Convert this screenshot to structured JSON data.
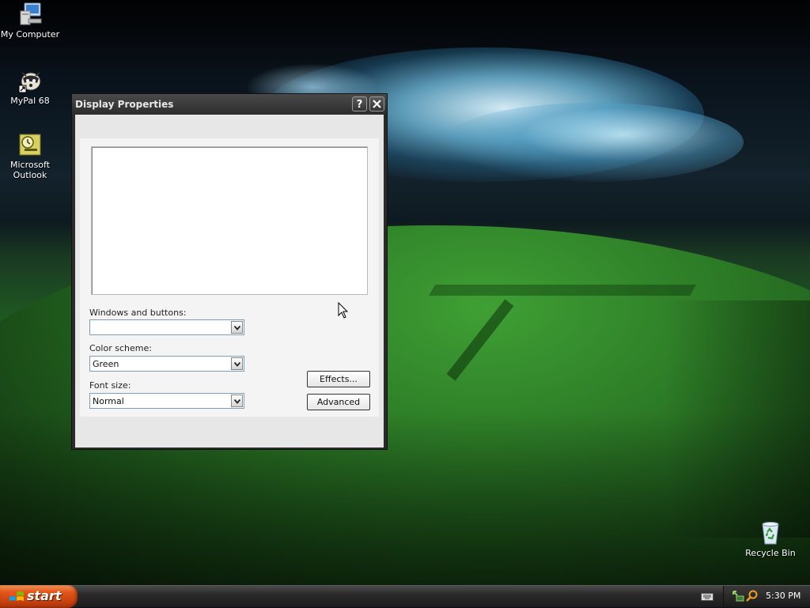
{
  "desktop": {
    "icons": [
      {
        "label": "My Computer",
        "icon": "computer-icon"
      },
      {
        "label": "MyPal 68",
        "icon": "mypal-icon"
      },
      {
        "label": "Microsoft\nOutlook",
        "icon": "outlook-icon"
      },
      {
        "label": "Recycle Bin",
        "icon": "recycle-bin-icon"
      }
    ]
  },
  "window": {
    "title": "Display Properties",
    "help_label": "?",
    "close_label": "✕",
    "fields": {
      "windows_buttons_label": "Windows and buttons:",
      "windows_buttons_value": "",
      "color_scheme_label": "Color scheme:",
      "color_scheme_value": "Green",
      "font_size_label": "Font size:",
      "font_size_value": "Normal"
    },
    "buttons": {
      "effects": "Effects...",
      "advanced": "Advanced"
    }
  },
  "taskbar": {
    "start_label": "start",
    "clock": "5:30 PM"
  },
  "colors": {
    "start_button": "#e3561b",
    "taskbar": "#2a2a2a",
    "titlebar": "#3a3a3a"
  }
}
